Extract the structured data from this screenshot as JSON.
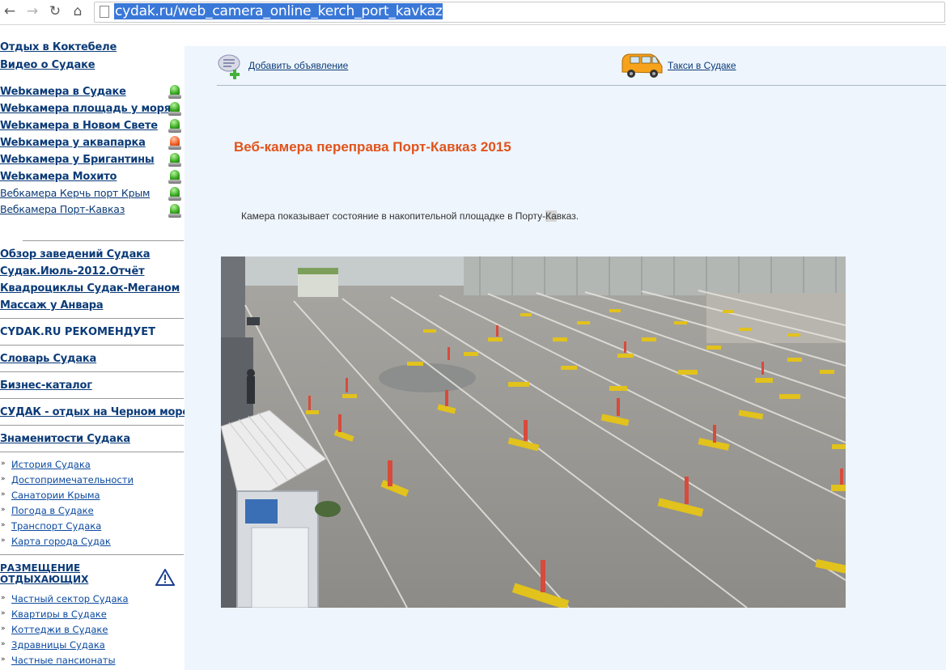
{
  "browser": {
    "back_icon": "back-arrow-icon",
    "forward_icon": "forward-arrow-icon",
    "reload_icon": "reload-icon",
    "home_icon": "home-icon",
    "url": "cydak.ru/web_camera_online_kerch_port_kavkaz"
  },
  "sidebar": {
    "top_links": [
      "Отдых в Коктебеле",
      "Видео о Судаке"
    ],
    "webcams": [
      {
        "label": "Webкамера в Судаке",
        "status": "green"
      },
      {
        "label": "Webкамера площадь у моря",
        "status": "green"
      },
      {
        "label": "Webкамера в Новом Свете",
        "status": "green"
      },
      {
        "label": "Webкамера у аквапарка",
        "status": "red"
      },
      {
        "label": "Webкамера у Бригантины",
        "status": "green"
      },
      {
        "label": "Webкамера Мохито",
        "status": "green"
      },
      {
        "label": "Вебкамера Керчь порт Крым",
        "status": "green"
      },
      {
        "label": "Вебкамера Порт-Кавказ",
        "status": "green"
      }
    ],
    "reviews": [
      "Обзор заведений Судака",
      "Судак.Июль-2012.Отчёт",
      "Квадроциклы Судак-Меганом",
      "Массаж у Анвара"
    ],
    "recommends": "CYDAK.RU РЕКОМЕНДУЕТ",
    "dictionary": "Словарь Судака ",
    "catalog": "Бизнес-каталог",
    "rest": "СУДАК - отдых на Черном море!",
    "famous": "Знаменитости Судака",
    "info_links": [
      "История Судака",
      "Достопримечательности",
      "Санатории Крыма",
      "Погода в Судаке",
      "Транспорт Судака",
      "Карта города Судак"
    ],
    "accommodation_line1": "РАЗМЕЩЕНИЕ",
    "accommodation_line2": "ОТДЫХАЮЩИХ",
    "accommodation_links": [
      "Частный сектор Судака",
      "Квартиры в Судаке",
      "Коттеджи в Судаке",
      "Здравницы Судака",
      "Частные пансионаты"
    ],
    "bullet": "»",
    "green_color": "#35a51e",
    "red_color": "#f05a1e"
  },
  "main": {
    "add_ad": "Добавить объявление",
    "taxi": "Такси в Судаке",
    "title": "Веб-камера переправа Порт-Кавказ 2015",
    "desc_before": "Камера показывает состояние в накопительной площадке в Порту-",
    "desc_highlight": "Ка",
    "desc_after": "вказ.",
    "title_color": "#e0531b",
    "link_color": "#0b3b78"
  }
}
